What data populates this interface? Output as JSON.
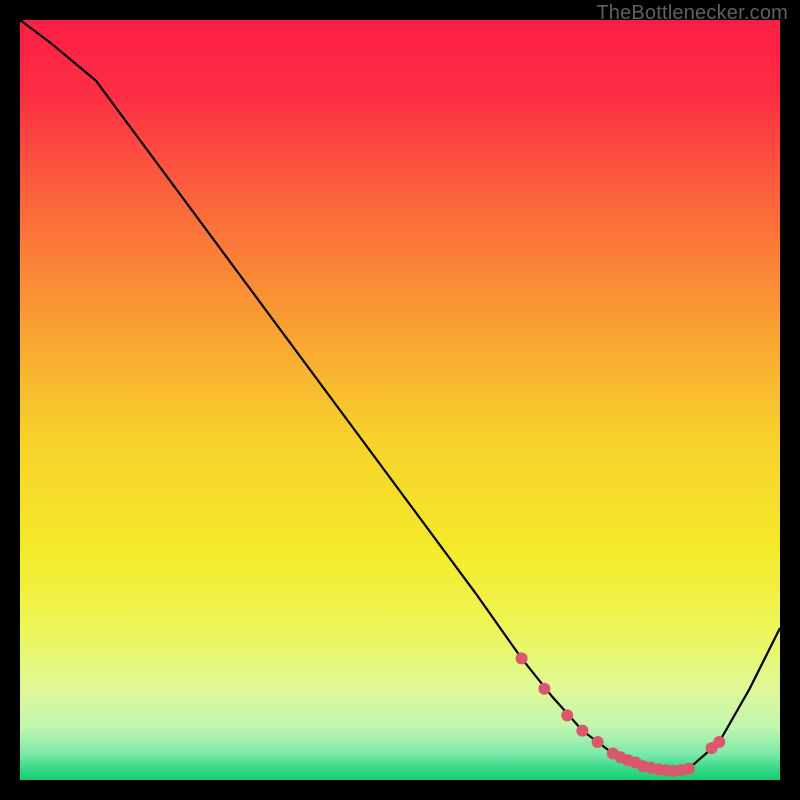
{
  "attribution": "TheBottlenecker.com",
  "chart_data": {
    "type": "line",
    "title": "",
    "xlabel": "",
    "ylabel": "",
    "xlim": [
      0,
      100
    ],
    "ylim": [
      0,
      100
    ],
    "series": [
      {
        "name": "curve",
        "x": [
          0,
          4,
          10,
          20,
          30,
          40,
          50,
          60,
          66,
          70,
          74,
          78,
          82,
          86,
          88,
          92,
          96,
          100
        ],
        "y": [
          100,
          97,
          92,
          78.5,
          65,
          51.5,
          38,
          24.5,
          16,
          11,
          6.5,
          3.5,
          1.8,
          1.2,
          1.5,
          5,
          12,
          20
        ]
      }
    ],
    "markers": {
      "name": "highlight-dots",
      "color": "#d9586b",
      "x": [
        66,
        69,
        72,
        74,
        76,
        78,
        79,
        80,
        81,
        82,
        83,
        84,
        85,
        86,
        87,
        88,
        91,
        92
      ],
      "y": [
        16,
        12,
        8.5,
        6.5,
        5,
        3.5,
        3.0,
        2.6,
        2.3,
        1.8,
        1.6,
        1.4,
        1.3,
        1.2,
        1.3,
        1.5,
        4.2,
        5
      ]
    },
    "gradient_stops": [
      {
        "offset": 0.0,
        "color": "#fd1e46"
      },
      {
        "offset": 0.1,
        "color": "#fd2f44"
      },
      {
        "offset": 0.25,
        "color": "#fb6a3b"
      },
      {
        "offset": 0.4,
        "color": "#f99f33"
      },
      {
        "offset": 0.55,
        "color": "#f8d12b"
      },
      {
        "offset": 0.7,
        "color": "#f4eb2a"
      },
      {
        "offset": 0.8,
        "color": "#eef658"
      },
      {
        "offset": 0.88,
        "color": "#e0f897"
      },
      {
        "offset": 0.93,
        "color": "#c1f6b0"
      },
      {
        "offset": 0.965,
        "color": "#7ee9a8"
      },
      {
        "offset": 0.985,
        "color": "#36d988"
      },
      {
        "offset": 1.0,
        "color": "#17cf73"
      }
    ]
  }
}
